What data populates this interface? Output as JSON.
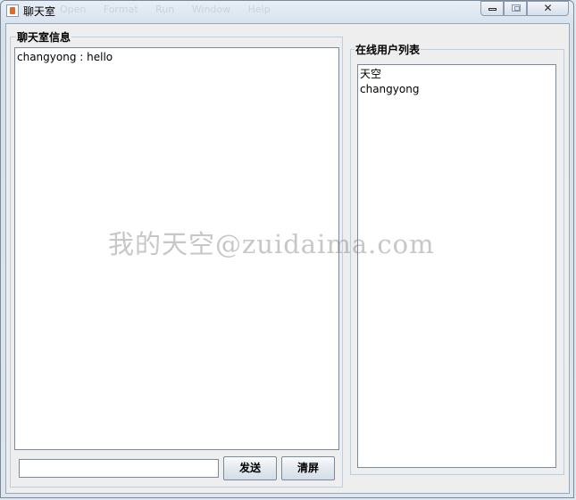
{
  "window": {
    "title": "聊天室",
    "ghost_menu": [
      "Open",
      "Format",
      "Run",
      "Window",
      "Help"
    ],
    "close_symbol": "✕"
  },
  "chat_panel": {
    "title": "聊天室信息",
    "messages": [
      "changyong : hello"
    ],
    "input_value": "",
    "send_label": "发送",
    "clear_label": "清屏"
  },
  "users_panel": {
    "title": "在线用户列表",
    "users": [
      "天空",
      "changyong"
    ]
  },
  "watermark": "我的天空@zuidaima.com"
}
